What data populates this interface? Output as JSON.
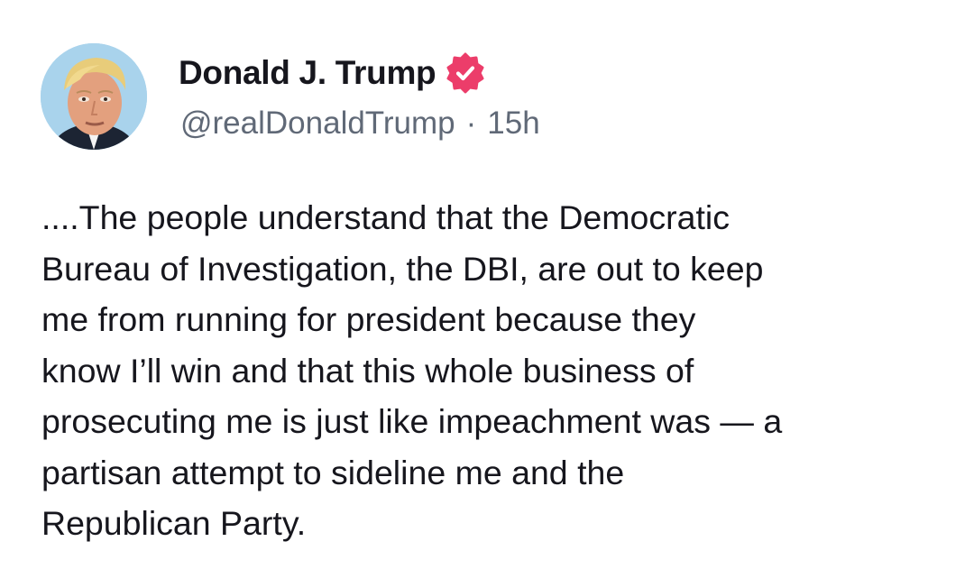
{
  "post": {
    "author": {
      "display_name": "Donald J. Trump",
      "handle": "@realDonaldTrump",
      "separator": "·",
      "timestamp": "15h",
      "verified_icon": "verified-badge-icon",
      "avatar": "avatar-photo"
    },
    "body_lines": [
      "....The people understand that the Democratic",
      "Bureau of Investigation, the DBI, are out to keep",
      "me from running for president because they",
      "know I’ll win and that this whole business of",
      "prosecuting me is just like impeachment was — a",
      "partisan attempt to sideline me and the",
      "Republican Party."
    ]
  },
  "colors": {
    "text_primary": "#16161d",
    "text_secondary": "#606977",
    "verified_badge": "#ec3d6a",
    "background": "#ffffff"
  }
}
